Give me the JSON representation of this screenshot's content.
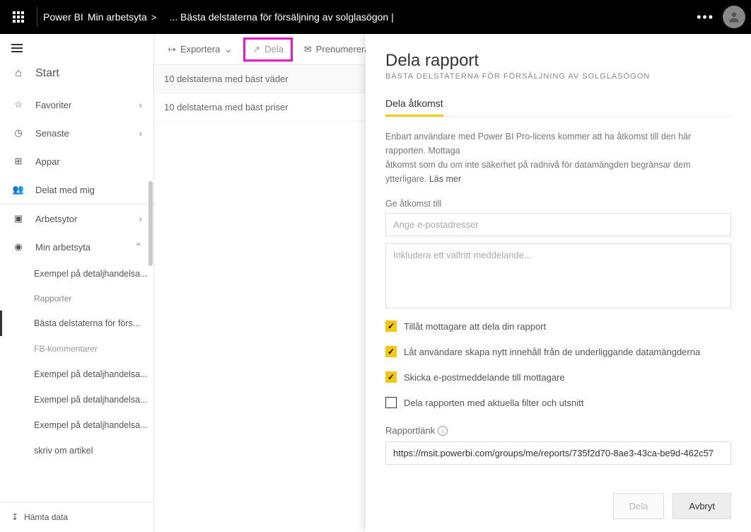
{
  "header": {
    "app": "Power BI",
    "workspace": "Min arbetsyta",
    "gt": ">",
    "report": "... Bästa delstaterna för försäljning av solglasögon |"
  },
  "sidebar": {
    "start": "Start",
    "favorites": "Favoriter",
    "recent": "Senaste",
    "apps": "Appar",
    "shared": "Delat med mig",
    "workspaces": "Arbetsytor",
    "myworkspace": "Min arbetsyta",
    "item0": "Exempel på detaljhandelsa...",
    "sub_header": "Rapporter",
    "item1": "Bästa delstaterna för förs...",
    "item2": "FB-kommentarer",
    "item3": "Exempel på detaljhandelsa...",
    "item4": "Exempel på detaljhandelsa...",
    "item5": "Exempel på detaljhandelsa...",
    "item6": "skriv om artikel",
    "getdata": "Hämta data"
  },
  "toolbar": {
    "export": "Exportera",
    "share": "Dela",
    "subscribe": "Prenumerera"
  },
  "pages": {
    "p0": "10 delstaterna med bäst väder",
    "p1": "10 delstaterna med bäst priser"
  },
  "panel": {
    "title": "Dela rapport",
    "subtitle": "BÄSTA DELSTATERNA FÖR FÖRSÄLJNING AV SOLGLASÖGON",
    "tab": "Dela åtkomst",
    "desc1": "Enbart användare med Power BI Pro-licens kommer att ha åtkomst till den här rapporten. Mottaga",
    "desc2": "åtkomst som du om inte säkerhet på radnivå för datamängden begränsar dem",
    "desc3a": "ytterligare. ",
    "desc3b": "Läs mer",
    "access_label": "Ge åtkomst till",
    "access_placeholder": "Ange e-postadresser",
    "message_placeholder": "Inkludera ett valfritt meddelande...",
    "opt1": "Tillåt mottagare att dela din rapport",
    "opt2": "Låt användare skapa nytt innehåll från de underliggande datamängderna",
    "opt3": "Skicka e-postmeddelande till mottagare",
    "opt4": "Dela rapporten med aktuella filter och utsnitt",
    "link_label": "Rapportlänk",
    "link_value": "https://msit.powerbi.com/groups/me/reports/735f2d70-8ae3-43ca-be9d-462c57",
    "btn_share": "Dela",
    "btn_cancel": "Avbryt"
  }
}
